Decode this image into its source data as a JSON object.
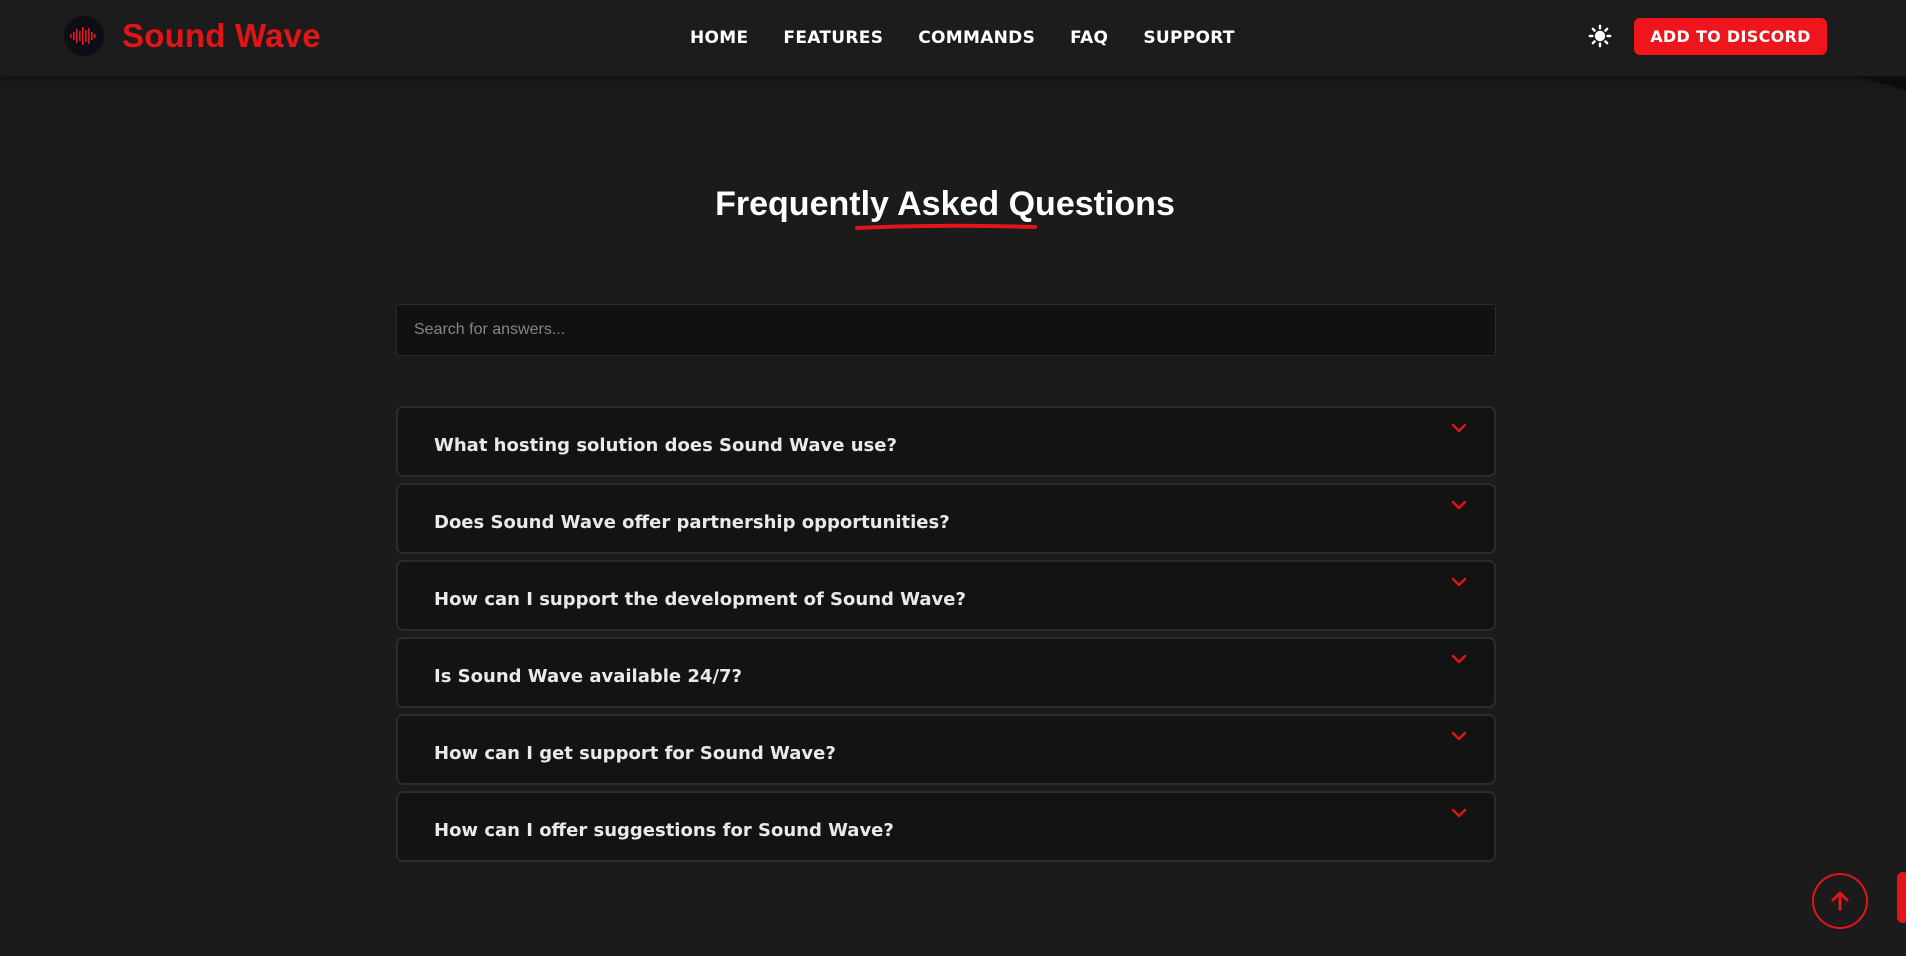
{
  "brand": {
    "name": "Sound Wave",
    "logo_icon": "sound-wave-logo-icon"
  },
  "nav": {
    "links": [
      {
        "label": "HOME"
      },
      {
        "label": "FEATURES"
      },
      {
        "label": "COMMANDS"
      },
      {
        "label": "FAQ"
      },
      {
        "label": "SUPPORT"
      }
    ],
    "theme_icon": "sun-icon",
    "cta_label": "ADD TO DISCORD"
  },
  "faq": {
    "title": "Frequently Asked Questions",
    "search_placeholder": "Search for answers...",
    "items": [
      {
        "question": "What hosting solution does Sound Wave use?"
      },
      {
        "question": "Does Sound Wave offer partnership opportunities?"
      },
      {
        "question": "How can I support the development of Sound Wave?"
      },
      {
        "question": "Is Sound Wave available 24/7?"
      },
      {
        "question": "How can I get support for Sound Wave?"
      },
      {
        "question": "How can I offer suggestions for Sound Wave?"
      }
    ]
  },
  "scroll_top_icon": "arrow-up-icon",
  "colors": {
    "accent": "#e2141c",
    "background": "#1b1b1b",
    "card": "#131313"
  }
}
